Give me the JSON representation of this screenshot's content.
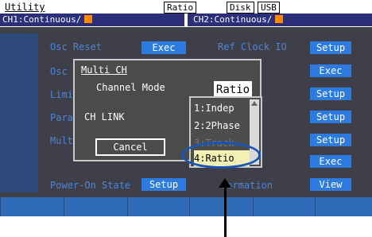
{
  "topbar": {
    "title": "Utility",
    "ratio_badge": "Ratio",
    "disk_badge": "Disk",
    "usb_badge": "USB",
    "ch1": "CH1:Continuous/",
    "ch2": "CH2:Continuous/"
  },
  "menu": {
    "osc_reset": "Osc Reset",
    "osc_reset_exec": "Exec",
    "osc_partial": "Osc",
    "limi_partial": "Limi",
    "para_partial": "Para",
    "mult_partial": "Mult",
    "power_on_state": "Power-On State",
    "power_on_setup": "Setup",
    "ref_clock_io": "Ref Clock IO",
    "information_partial": "formation",
    "right_buttons": [
      "Setup",
      "Exec",
      "Setup",
      "Setup",
      "Setup",
      "Exec",
      "View"
    ]
  },
  "dialog": {
    "title": "Multi CH",
    "channel_mode_label": "Channel Mode",
    "ch_link_label": "CH LINK",
    "cancel_label": "Cancel",
    "current_value": "Ratio"
  },
  "dropdown": {
    "options": [
      "1:Indep",
      "2:2Phase",
      "3:Track",
      "4:Ratio"
    ],
    "selected": "4:Ratio"
  },
  "colors": {
    "accent": "#2e7be0",
    "highlight_ellipse": "#1a56b5",
    "selected_option": "#f3f0b5",
    "channel_marker": "#ff8a00"
  }
}
